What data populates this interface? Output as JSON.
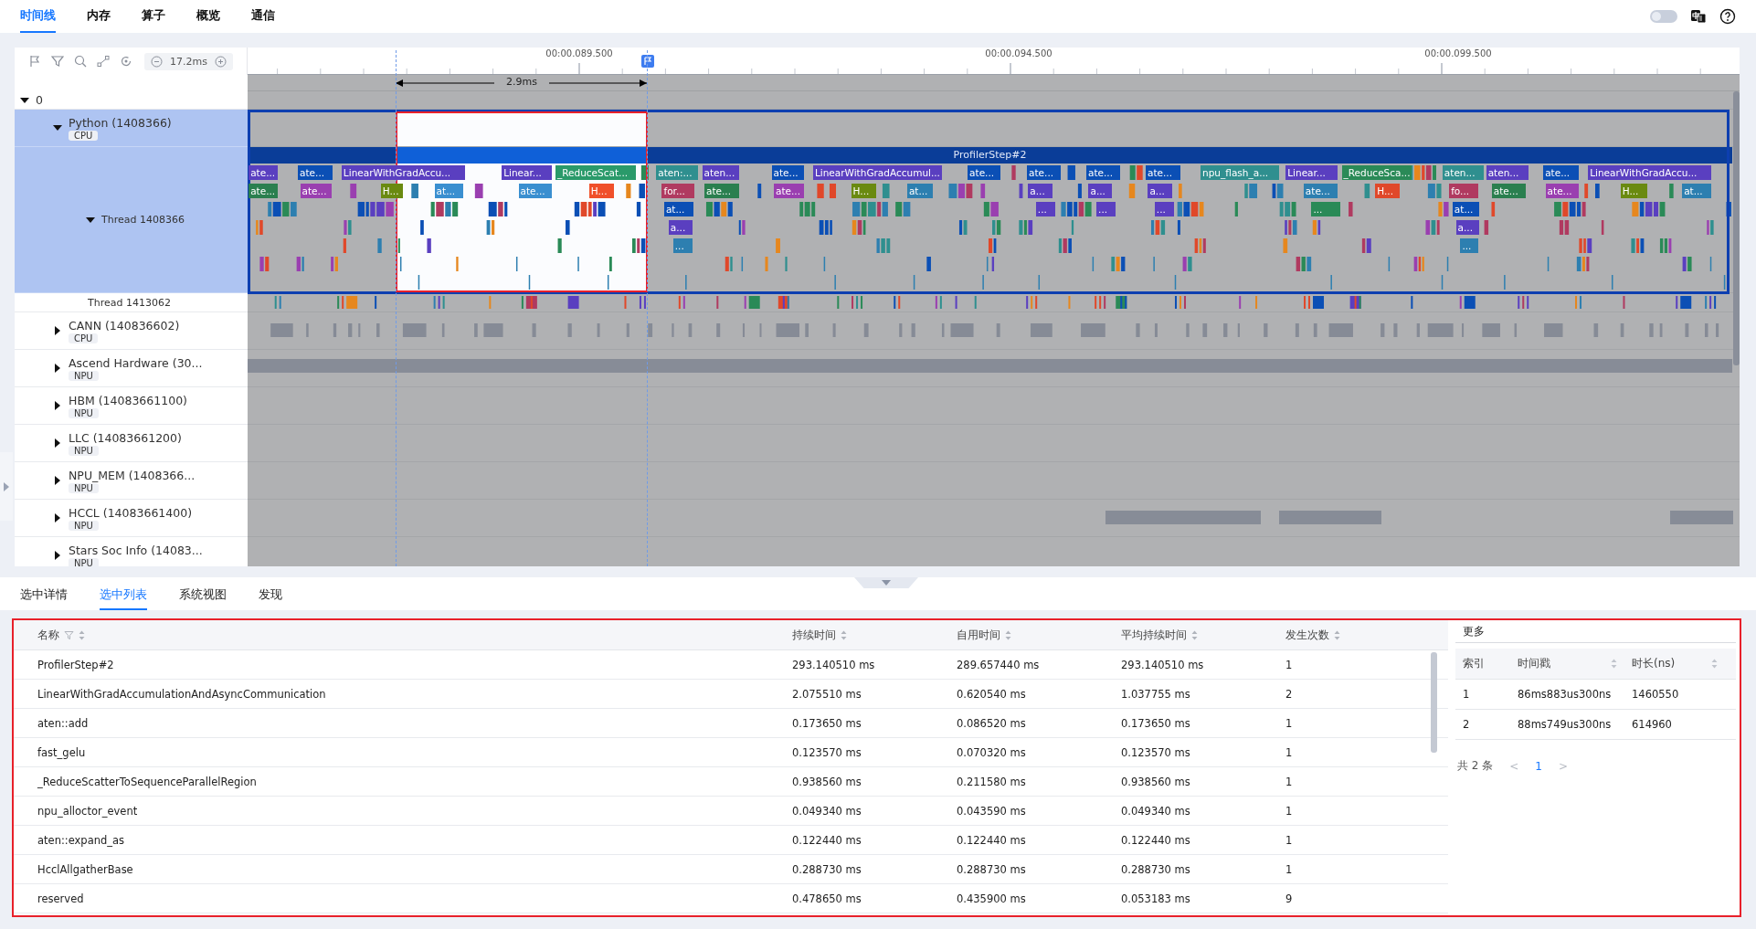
{
  "top_tabs": [
    {
      "label": "时间线",
      "selected": true
    },
    {
      "label": "内存",
      "selected": false
    },
    {
      "label": "算子",
      "selected": false
    },
    {
      "label": "概览",
      "selected": false
    },
    {
      "label": "通信",
      "selected": false
    }
  ],
  "theme_toggle": {
    "on": false
  },
  "toolbar": {
    "zoom_reading": "17.2ms"
  },
  "ruler": {
    "labels": [
      "00:00.089.500",
      "00:00.094.500",
      "00:00.099.500"
    ]
  },
  "selection": {
    "duration": "2.9ms"
  },
  "tracks": [
    {
      "name": "0",
      "kind": "root",
      "expanded": true,
      "selected": false,
      "children": [
        {
          "name": "Python (1408366)",
          "tag": "CPU",
          "kind": "empty",
          "expanded": true,
          "selected": true,
          "children": [
            {
              "name": "Thread 1408366",
              "kind": "flame",
              "expanded": true,
              "selected": true
            },
            {
              "name": "Thread 1413062",
              "kind": "ticks",
              "selected": false
            }
          ]
        },
        {
          "name": "CANN (140836602)",
          "tag": "CPU",
          "kind": "blocks",
          "expanded": false,
          "selected": false
        },
        {
          "name": "Ascend Hardware (30...",
          "tag": "NPU",
          "kind": "band",
          "expanded": false,
          "selected": false
        },
        {
          "name": "HBM (14083661100)",
          "tag": "NPU",
          "kind": "empty",
          "expanded": false,
          "selected": false
        },
        {
          "name": "LLC (14083661200)",
          "tag": "NPU",
          "kind": "empty",
          "expanded": false,
          "selected": false
        },
        {
          "name": "NPU_MEM (1408366...",
          "tag": "NPU",
          "kind": "empty",
          "expanded": false,
          "selected": false
        },
        {
          "name": "HCCL (14083661400)",
          "tag": "NPU",
          "kind": "spans",
          "expanded": false,
          "selected": false
        },
        {
          "name": "Stars Soc Info (14083...",
          "tag": "NPU",
          "kind": "empty",
          "expanded": false,
          "selected": false
        }
      ]
    }
  ],
  "flame": {
    "step_label": "ProfilerStep#2",
    "lanes": [
      {
        "slices": [
          {
            "label": "ate...",
            "color": "#5a3fc0"
          },
          {
            "label": "ate...",
            "color": "#0b4fb5"
          },
          {
            "label": "LinearWithGradAccu...",
            "color": "#5a3fc0"
          },
          {
            "label": "Linear...",
            "color": "#5a3fc0"
          },
          {
            "label": "_ReduceScat...",
            "color": "#2a9a6a"
          },
          {
            "label": "aten:...",
            "color": "#2f8f8f"
          },
          {
            "label": "aten...",
            "color": "#5a3fc0"
          },
          {
            "label": "ate...",
            "color": "#0b4fb5"
          },
          {
            "label": "LinearWithGradAccumul...",
            "color": "#5a3fc0"
          },
          {
            "label": "ate...",
            "color": "#0b4fb5"
          },
          {
            "label": "ate...",
            "color": "#0b4fb5"
          },
          {
            "label": "ate...",
            "color": "#0b4fb5"
          },
          {
            "label": "ate...",
            "color": "#0b4fb5"
          },
          {
            "label": "npu_flash_a...",
            "color": "#2f8f8f"
          },
          {
            "label": "Linear...",
            "color": "#5a3fc0"
          },
          {
            "label": "_ReduceSca...",
            "color": "#2a8a57"
          },
          {
            "label": "aten...",
            "color": "#2f8f8f"
          },
          {
            "label": "aten...",
            "color": "#5a3fc0"
          },
          {
            "label": "ate...",
            "color": "#0b4fb5"
          },
          {
            "label": "LinearWithGradAccu...",
            "color": "#5a3fc0"
          }
        ]
      },
      {
        "slices": [
          {
            "label": "ate...",
            "color": "#2a7f4f"
          },
          {
            "label": "ate...",
            "color": "#9a3fb0"
          },
          {
            "label": "H...",
            "color": "#6a8a10"
          },
          {
            "label": "at...",
            "color": "#3a8fd0"
          },
          {
            "label": "ate...",
            "color": "#3a8fd0"
          },
          {
            "label": "H...",
            "color": "#f0502a"
          },
          {
            "label": "for...",
            "color": "#b03a60"
          },
          {
            "label": "ate...",
            "color": "#2a7f4f"
          },
          {
            "label": "ate...",
            "color": "#9a3fb0"
          },
          {
            "label": "H...",
            "color": "#6a8a10"
          },
          {
            "label": "at...",
            "color": "#2d7fb0"
          },
          {
            "label": "a...",
            "color": "#5a3fc0"
          },
          {
            "label": "a...",
            "color": "#5a3fc0"
          },
          {
            "label": "a...",
            "color": "#5a3fc0"
          },
          {
            "label": "ate...",
            "color": "#2d7fb0"
          },
          {
            "label": "H...",
            "color": "#e0482a"
          },
          {
            "label": "fo...",
            "color": "#b03a60"
          },
          {
            "label": "ate...",
            "color": "#2a7f4f"
          },
          {
            "label": "ate...",
            "color": "#9a3fb0"
          },
          {
            "label": "H...",
            "color": "#6a8a10"
          },
          {
            "label": "at...",
            "color": "#2d7fb0"
          }
        ]
      },
      {
        "slices": [
          {
            "label": "at...",
            "color": "#0b4fb5"
          },
          {
            "label": "...",
            "color": "#5a3fc0"
          },
          {
            "label": "...",
            "color": "#5a3fc0"
          },
          {
            "label": "...",
            "color": "#5a3fc0"
          },
          {
            "label": "...",
            "color": "#2a8a57"
          },
          {
            "label": "at...",
            "color": "#0b4fb5"
          }
        ]
      },
      {
        "slices": [
          {
            "label": "a...",
            "color": "#5a3fc0"
          },
          {
            "label": "a...",
            "color": "#5a3fc0"
          }
        ]
      },
      {
        "slices": [
          {
            "label": "...",
            "color": "#2d7fb0"
          },
          {
            "label": "...",
            "color": "#2d7fb0"
          }
        ]
      }
    ]
  },
  "bottom_tabs": [
    {
      "label": "选中详情",
      "selected": false
    },
    {
      "label": "选中列表",
      "selected": true
    },
    {
      "label": "系统视图",
      "selected": false
    },
    {
      "label": "发现",
      "selected": false
    }
  ],
  "table": {
    "columns": [
      {
        "label": "名称",
        "filterable": true
      },
      {
        "label": "持续时间",
        "filterable": false
      },
      {
        "label": "自用时间",
        "filterable": false
      },
      {
        "label": "平均持续时间",
        "filterable": false
      },
      {
        "label": "发生次数",
        "filterable": false
      }
    ],
    "rows": [
      [
        "ProfilerStep#2",
        "293.140510 ms",
        "289.657440 ms",
        "293.140510 ms",
        "1"
      ],
      [
        "LinearWithGradAccumulationAndAsyncCommunication",
        "2.075510 ms",
        "0.620540 ms",
        "1.037755 ms",
        "2"
      ],
      [
        "aten::add",
        "0.173650 ms",
        "0.086520 ms",
        "0.173650 ms",
        "1"
      ],
      [
        "fast_gelu",
        "0.123570 ms",
        "0.070320 ms",
        "0.123570 ms",
        "1"
      ],
      [
        "_ReduceScatterToSequenceParallelRegion",
        "0.938560 ms",
        "0.211580 ms",
        "0.938560 ms",
        "1"
      ],
      [
        "npu_alloctor_event",
        "0.049340 ms",
        "0.043590 ms",
        "0.049340 ms",
        "1"
      ],
      [
        "aten::expand_as",
        "0.122440 ms",
        "0.122440 ms",
        "0.122440 ms",
        "1"
      ],
      [
        "HcclAllgatherBase",
        "0.288730 ms",
        "0.288730 ms",
        "0.288730 ms",
        "1"
      ],
      [
        "reserved",
        "0.478650 ms",
        "0.435900 ms",
        "0.053183 ms",
        "9"
      ]
    ]
  },
  "more": {
    "title": "更多",
    "columns": [
      {
        "label": "索引",
        "sortable": false
      },
      {
        "label": "时间戳",
        "sortable": true
      },
      {
        "label": "时长(ns)",
        "sortable": true
      }
    ],
    "rows": [
      [
        "1",
        "86ms883us300ns",
        "1460550"
      ],
      [
        "2",
        "88ms749us300ns",
        "614960"
      ]
    ],
    "total": "共 2 条",
    "prev": "<",
    "page": "1",
    "next": ">"
  }
}
